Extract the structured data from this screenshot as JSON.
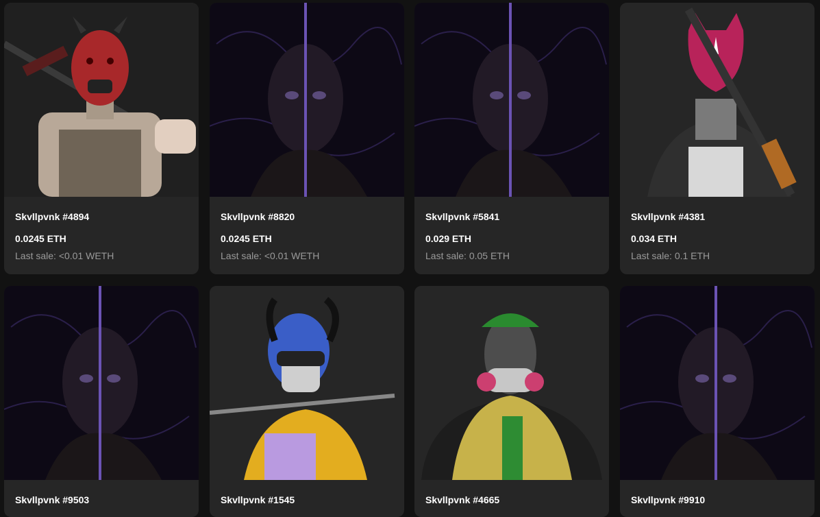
{
  "cards": [
    {
      "name": "Skvllpvnk #4894",
      "price": "0.0245 ETH",
      "last_sale": "Last sale: <0.01 WETH",
      "art": "demon-mask-soldier"
    },
    {
      "name": "Skvllpvnk #8820",
      "price": "0.0245 ETH",
      "last_sale": "Last sale: <0.01 WETH",
      "art": "split-skull-dark"
    },
    {
      "name": "Skvllpvnk #5841",
      "price": "0.029 ETH",
      "last_sale": "Last sale: 0.05 ETH",
      "art": "split-skull-dark"
    },
    {
      "name": "Skvllpvnk #4381",
      "price": "0.034 ETH",
      "last_sale": "Last sale: 0.1 ETH",
      "art": "fox-mask-rifle"
    },
    {
      "name": "Skvllpvnk #9503",
      "art": "split-skull-dark"
    },
    {
      "name": "Skvllpvnk #1545",
      "art": "horned-skull-katana"
    },
    {
      "name": "Skvllpvnk #4665",
      "art": "gas-mask-jacket"
    },
    {
      "name": "Skvllpvnk #9910",
      "art": "split-skull-dark"
    }
  ],
  "colors": {
    "background": "#121212",
    "card": "#262626",
    "muted_text": "#9a9a9a"
  }
}
